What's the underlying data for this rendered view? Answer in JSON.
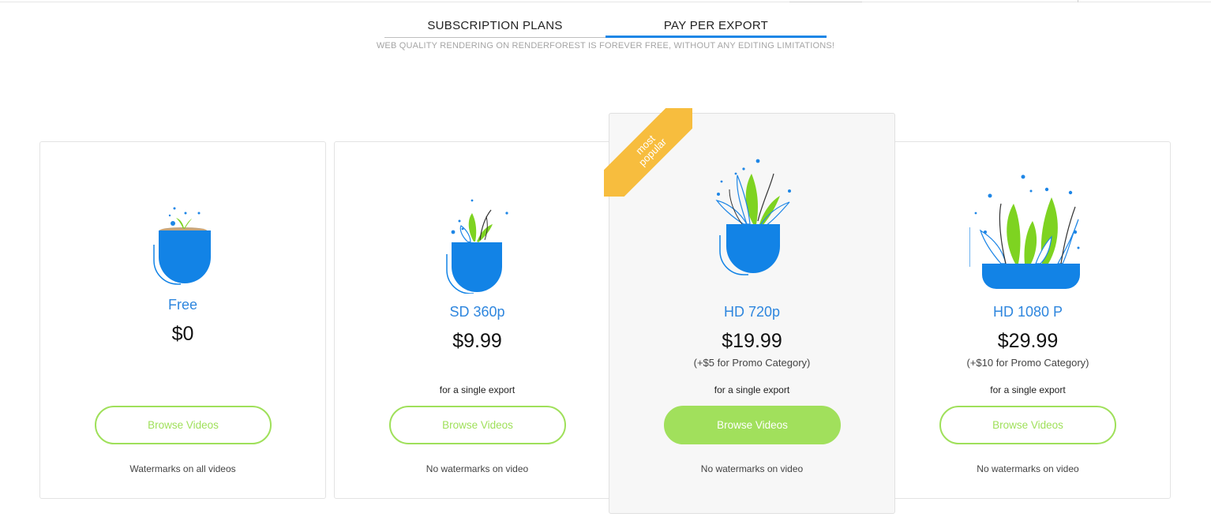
{
  "tabs": [
    {
      "label": "SUBSCRIPTION PLANS",
      "active": false
    },
    {
      "label": "PAY PER EXPORT",
      "active": true
    }
  ],
  "subtitle": "WEB QUALITY RENDERING ON RENDERFOREST IS FOREVER FREE, WITHOUT ANY EDITING LIMITATIONS!",
  "ribbon": "most popular",
  "plans": [
    {
      "name": "Free",
      "price": "$0",
      "extra": "",
      "per": "",
      "button": "Browse Videos",
      "note": "Watermarks on all videos",
      "icon": "plant-small-icon"
    },
    {
      "name": "SD 360p",
      "price": "$9.99",
      "extra": "",
      "per": "for a single export",
      "button": "Browse Videos",
      "note": "No watermarks on video",
      "icon": "plant-medium-icon"
    },
    {
      "name": "HD 720p",
      "price": "$19.99",
      "extra": "(+$5 for Promo Category)",
      "per": "for a single export",
      "button": "Browse Videos",
      "note": "No watermarks on video",
      "icon": "plant-large-icon"
    },
    {
      "name": "HD 1080 P",
      "price": "$29.99",
      "extra": "(+$10 for Promo Category)",
      "per": "for a single export",
      "button": "Browse Videos",
      "note": "No watermarks on video",
      "icon": "plant-xlarge-icon"
    }
  ],
  "colors": {
    "accent_blue": "#1e86e6",
    "green": "#9fe05a",
    "ribbon": "#f7bd3e"
  }
}
